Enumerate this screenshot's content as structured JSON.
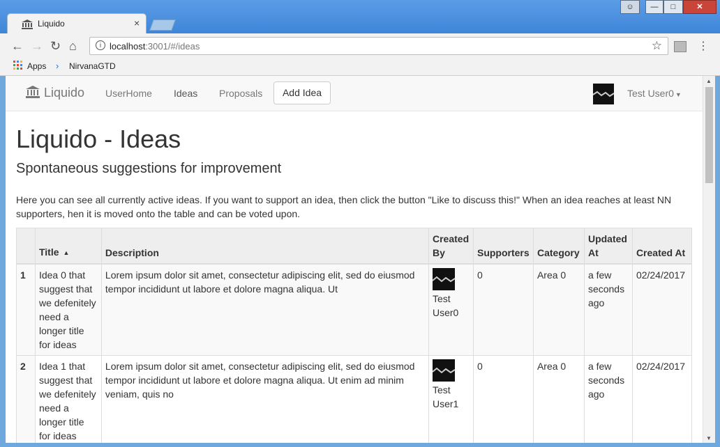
{
  "browser": {
    "tab_title": "Liquido",
    "tab_close": "×",
    "url_host": "localhost",
    "url_path": ":3001/#/ideas",
    "bookmarks": [
      {
        "label": "Apps"
      },
      {
        "label": "NirvanaGTD"
      }
    ]
  },
  "navbar": {
    "brand": "Liquido",
    "links": [
      {
        "label": "UserHome"
      },
      {
        "label": "Ideas"
      },
      {
        "label": "Proposals"
      }
    ],
    "add_button": "Add Idea",
    "user": "Test User0"
  },
  "page": {
    "title": "Liquido - Ideas",
    "subtitle": "Spontaneous suggestions for improvement",
    "intro": "Here you can see all currently active ideas. If you want to support an idea, then click the button \"Like to discuss this!\" When an idea reaches at least NN supporters, hen it is moved onto the table and can be voted upon."
  },
  "table": {
    "headers": [
      "",
      "Title",
      "Description",
      "Created By",
      "Supporters",
      "Category",
      "Updated At",
      "Created At"
    ],
    "sort_indicator": "▲",
    "rows": [
      {
        "num": "1",
        "title": "Idea 0 that suggest that we defenitely need a longer title for ideas",
        "description": "Lorem ipsum dolor sit amet, consectetur adipiscing elit, sed do eiusmod tempor incididunt ut labore et dolore magna aliqua. Ut",
        "created_by": "Test User0",
        "supporters": "0",
        "category": "Area 0",
        "updated_at": "a few seconds ago",
        "created_at": "02/24/2017"
      },
      {
        "num": "2",
        "title": "Idea 1 that suggest that we defenitely need a longer title for ideas",
        "description": "Lorem ipsum dolor sit amet, consectetur adipiscing elit, sed do eiusmod tempor incididunt ut labore et dolore magna aliqua. Ut enim ad minim veniam, quis no",
        "created_by": "Test User1",
        "supporters": "0",
        "category": "Area 0",
        "updated_at": "a few seconds ago",
        "created_at": "02/24/2017"
      }
    ]
  },
  "colors": {
    "chrome_frame": "#4a90e2",
    "navbar_bg": "#f8f8f8",
    "table_header_bg": "#eeeeee"
  }
}
